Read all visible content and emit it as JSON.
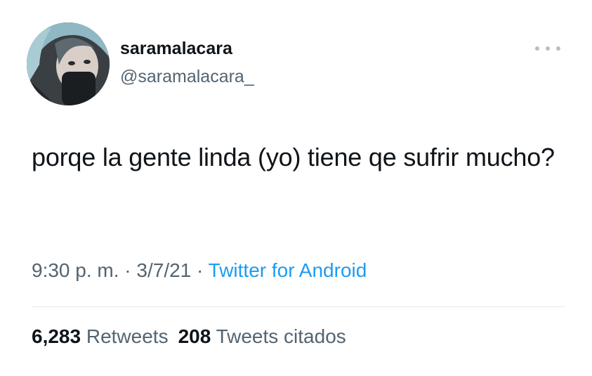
{
  "user": {
    "display_name": "saramalacara",
    "handle": "@saramalacara_"
  },
  "tweet": {
    "text": "porqe la gente linda (yo) tiene qe sufrir mucho?"
  },
  "meta": {
    "time": "9:30 p. m.",
    "date": "3/7/21",
    "separator": "·",
    "source": "Twitter for Android"
  },
  "stats": {
    "retweets_count": "6,283",
    "retweets_label": "Retweets",
    "quotes_count": "208",
    "quotes_label": "Tweets citados"
  },
  "colors": {
    "text": "#0f1419",
    "secondary": "#536471",
    "link": "#1d9bf0",
    "divider": "#e6eaed"
  },
  "icons": {
    "more": "more-horizontal-icon"
  }
}
